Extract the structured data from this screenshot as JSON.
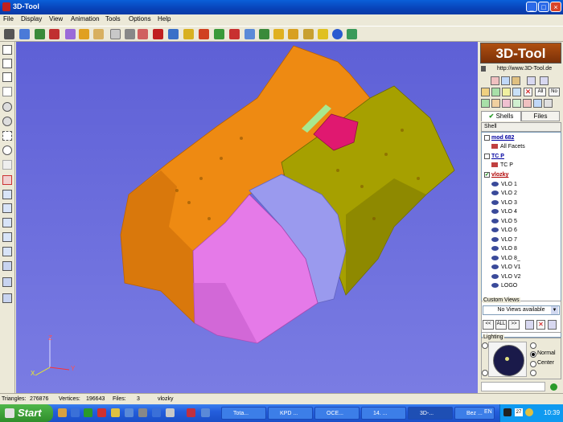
{
  "window": {
    "title": "3D-Tool",
    "controls": [
      "minimize-icon",
      "maximize-icon",
      "close-icon"
    ]
  },
  "menu": [
    "File",
    "Display",
    "View",
    "Animation",
    "Tools",
    "Options",
    "Help"
  ],
  "right_panel": {
    "logo": "3D-Tool",
    "url": "http://www.3D-Tool.de",
    "buttons": {
      "all": "All",
      "no": "No"
    },
    "tabs": {
      "shells": "Shells",
      "files": "Files"
    },
    "tree_header": "Shell",
    "tree": [
      {
        "type": "shell",
        "label": "mod 682"
      },
      {
        "type": "facet",
        "label": "All Facets"
      },
      {
        "type": "shell",
        "label": "TC P"
      },
      {
        "type": "facet",
        "label": "TC P"
      },
      {
        "type": "shell",
        "label": "vlozky"
      },
      {
        "type": "item",
        "label": "VLO 1"
      },
      {
        "type": "item",
        "label": "VLO 2"
      },
      {
        "type": "item",
        "label": "VLO 3"
      },
      {
        "type": "item",
        "label": "VLO 4"
      },
      {
        "type": "item",
        "label": "VLO 5"
      },
      {
        "type": "item",
        "label": "VLO 6"
      },
      {
        "type": "item",
        "label": "VLO 7"
      },
      {
        "type": "item",
        "label": "VLO 8"
      },
      {
        "type": "item",
        "label": "VLO 8_"
      },
      {
        "type": "item",
        "label": "VLO V1"
      },
      {
        "type": "item",
        "label": "VLO V2"
      },
      {
        "type": "item",
        "label": "LOGO"
      }
    ],
    "custom_views": {
      "label": "Custom Views",
      "select": "No Views available",
      "nav": [
        "<<",
        "ALL",
        ">>"
      ]
    },
    "lighting": {
      "label": "Lighting",
      "options": [
        "Normal",
        "Center"
      ],
      "selected": "Normal"
    }
  },
  "axes": {
    "x": "X",
    "y": "Y",
    "z": "Z"
  },
  "status": {
    "triangles_label": "Triangles:",
    "triangles": "276876",
    "vertices_label": "Vertices:",
    "vertices": "196643",
    "files_label": "Files:",
    "files": "3",
    "selection": "vlozky"
  },
  "taskbar": {
    "start": "Start",
    "tasks": [
      "Tota...",
      "KPD ...",
      "OCE...",
      "14. ...",
      "3D-...",
      "Bez ..."
    ],
    "active_task": "3D-...",
    "language": "EN",
    "badge": "27",
    "clock": "10:39"
  },
  "colors": {
    "viewport": "#6a6cdc",
    "orange": "#ee8a12",
    "olive": "#a6a000",
    "pink": "#e57ae8",
    "lavender": "#9a9aee",
    "magenta": "#e01870"
  }
}
